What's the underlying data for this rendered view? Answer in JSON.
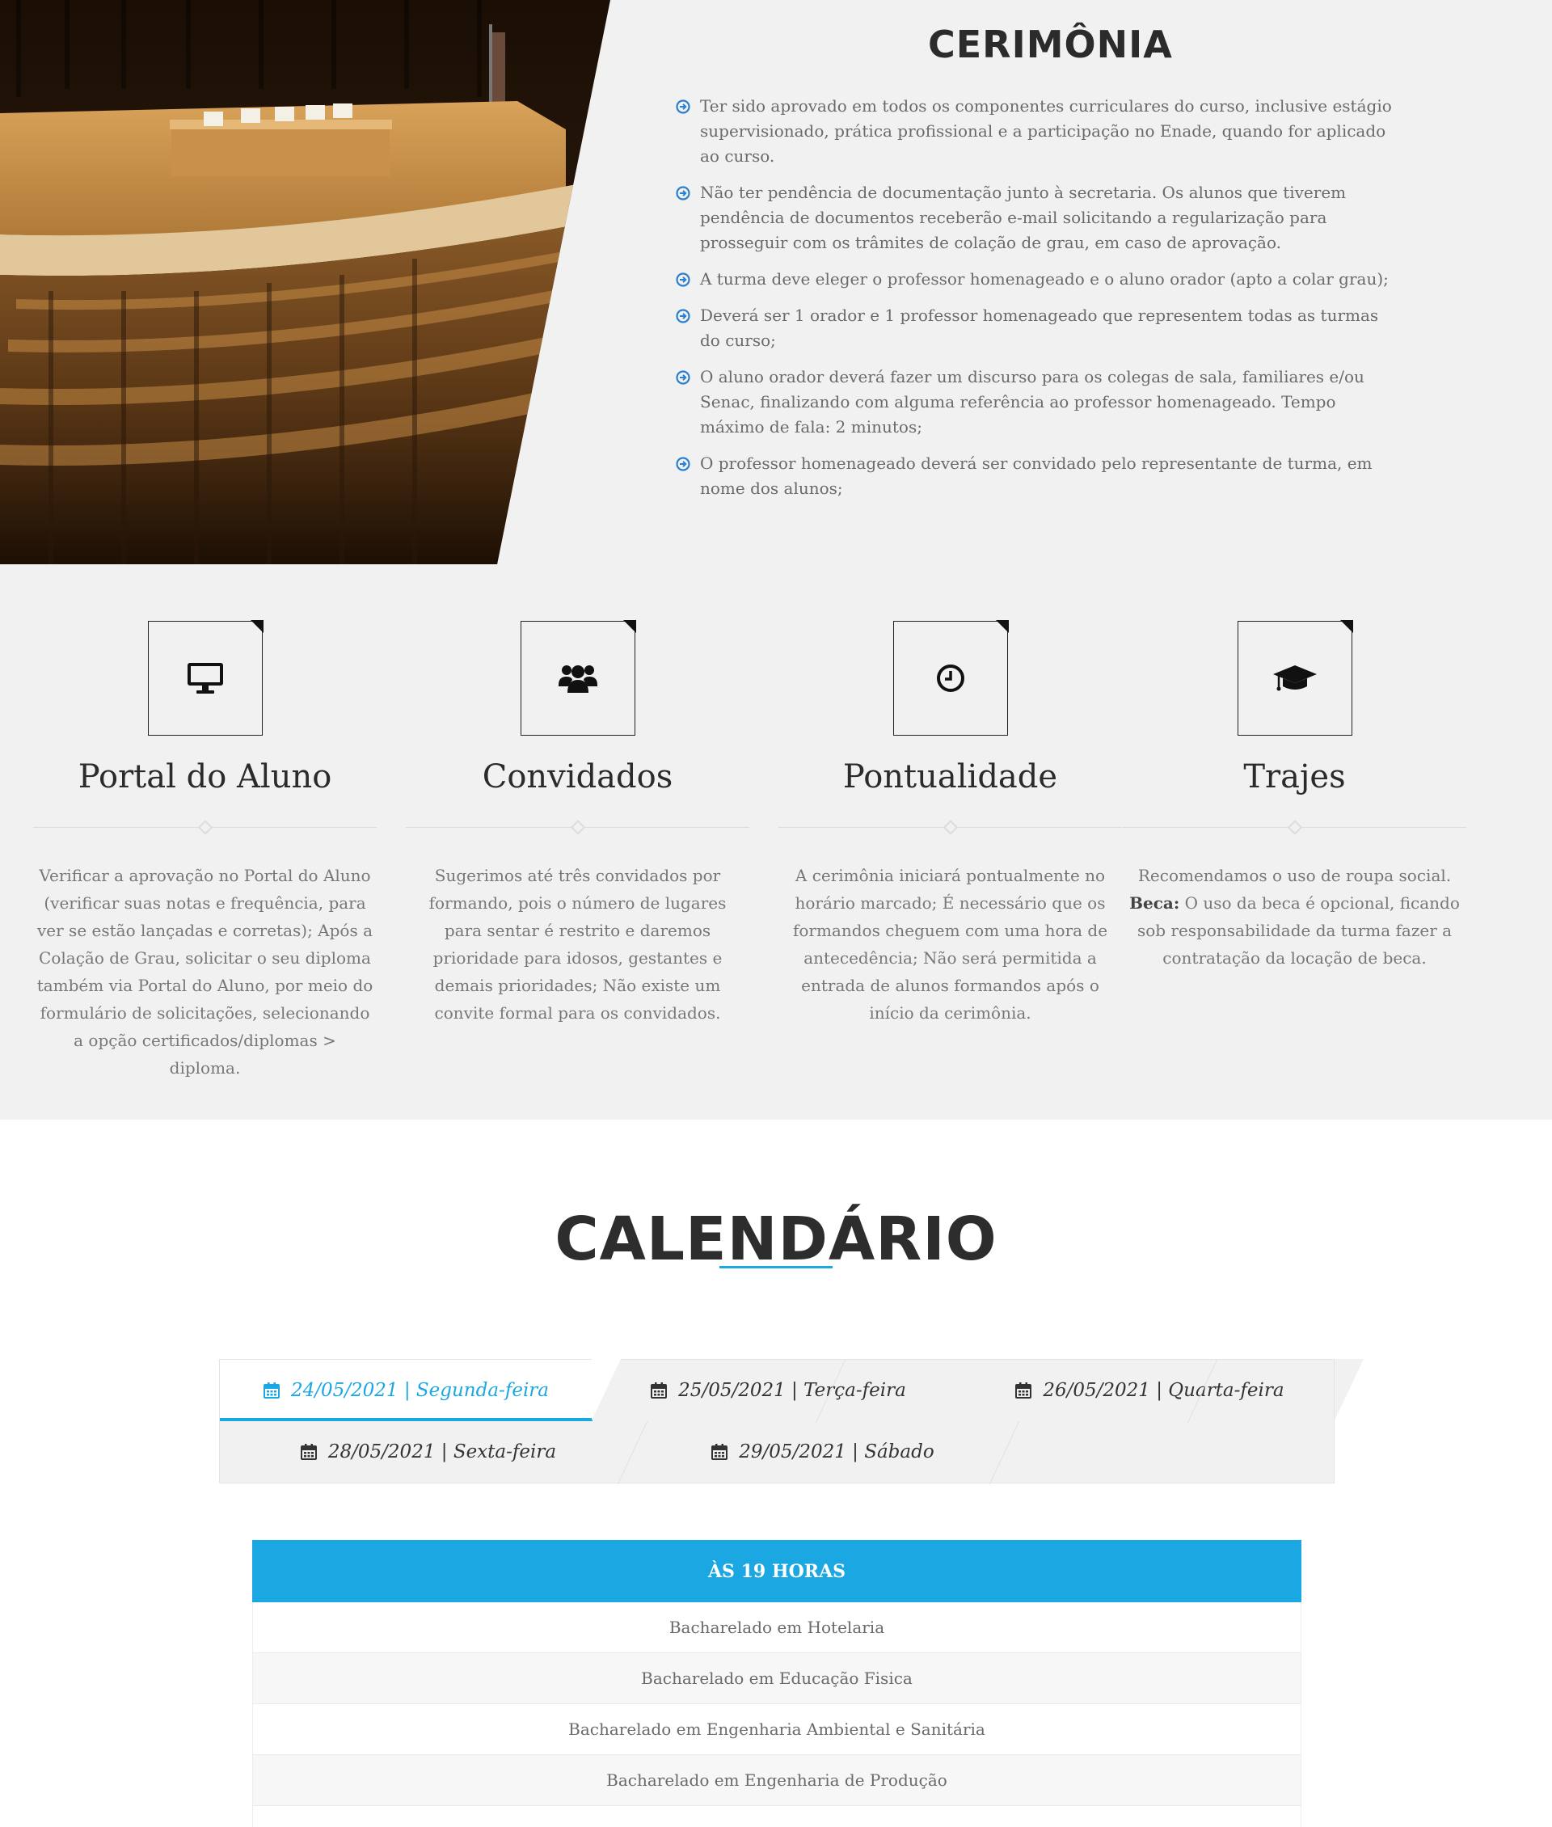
{
  "ceremony": {
    "title": "CERIMÔNIA",
    "items": [
      "Ter sido aprovado em todos os componentes curriculares do curso, inclusive estágio supervisionado, prática profissional e a participação no Enade, quando for aplicado ao curso.",
      "Não ter pendência de documentação junto à secretaria. Os alunos que tiverem pendência de documentos receberão e-mail solicitando a regularização para prosseguir com os trâmites de colação de grau, em caso de aprovação.",
      "A turma deve eleger o professor homenageado e o aluno orador (apto a colar grau);",
      "Deverá ser 1 orador e 1 professor homenageado que representem todas as turmas do curso;",
      "O aluno orador deverá fazer um discurso para os colegas de sala, familiares e/ou Senac, finalizando com alguma referência ao professor homenageado. Tempo máximo de fala: 2 minutos;",
      "O professor homenageado deverá ser convidado pelo representante de turma, em nome dos alunos;"
    ]
  },
  "features": [
    {
      "icon": "desktop-icon",
      "title": "Portal do Aluno",
      "text": "Verificar a aprovação no Portal do Aluno (verificar suas notas e frequência, para ver se estão lançadas e corretas); Após a Colação de Grau, solicitar o seu diploma também via Portal do Aluno, por meio do formulário de solicitações, selecionando a opção certificados/diplomas > diploma."
    },
    {
      "icon": "users-icon",
      "title": "Convidados",
      "text": "Sugerimos até três convidados por formando, pois o número de lugares para sentar é restrito e daremos prioridade para idosos, gestantes e demais prioridades; Não existe um convite formal para os convidados."
    },
    {
      "icon": "clock-icon",
      "title": "Pontualidade",
      "text": "A cerimônia iniciará pontualmente no horário marcado; É necessário que os formandos cheguem com uma hora de antecedência; Não será permitida a entrada de alunos formandos após o início da cerimônia."
    },
    {
      "icon": "graduation-cap-icon",
      "title": "Trajes",
      "text_prefix": "Recomendamos o uso de roupa social.",
      "text_bold": "Beca:",
      "text": "O uso da beca é opcional, ficando sob responsabilidade da turma fazer a contratação da locação de beca."
    }
  ],
  "calendar": {
    "title": "CALENDÁRIO",
    "tabs": [
      "24/05/2021 | Segunda-feira",
      "25/05/2021 | Terça-feira",
      "26/05/2021 | Quarta-feira",
      "28/05/2021 | Sexta-feira",
      "29/05/2021 | Sábado"
    ],
    "active_tab": 0,
    "table_header": "ÀS 19 HORAS",
    "rows": [
      "Bacharelado em Hotelaria",
      "Bacharelado em Educação Fisica",
      "Bacharelado em Engenharia Ambiental e Sanitária",
      "Bacharelado em Engenharia de Produção"
    ]
  },
  "colors": {
    "accent": "#1ba7e2",
    "bullet": "#2b7fd1",
    "section_bg": "#f1f1f1",
    "heading": "#2b2b2b"
  }
}
